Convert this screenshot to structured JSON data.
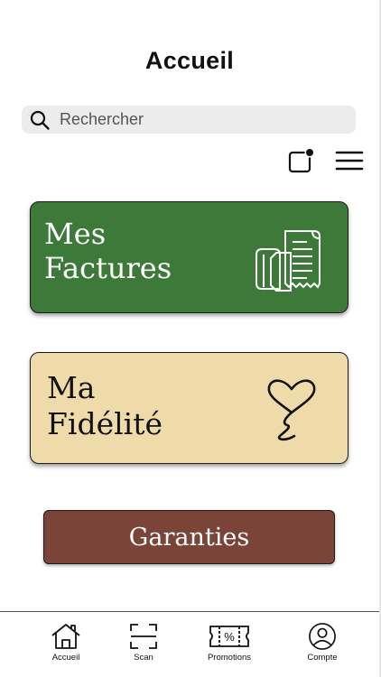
{
  "header": {
    "title": "Accueil"
  },
  "search": {
    "placeholder": "Rechercher",
    "icon": "search-icon"
  },
  "toolbar": {
    "notification_icon": "notification-icon",
    "menu_icon": "hamburger-menu-icon"
  },
  "cards": {
    "factures": {
      "line1": "Mes",
      "line2": "Factures",
      "color": "#3d7a3a",
      "icon": "receipts-icon"
    },
    "fidelite": {
      "line1": "Ma",
      "line2": "Fidélité",
      "color": "#efdaa9",
      "icon": "heart-balloon-icon"
    }
  },
  "garanties": {
    "label": "Garanties",
    "color": "#7a4538"
  },
  "bottom_nav": {
    "items": [
      {
        "label": "Accueil",
        "icon": "home-icon"
      },
      {
        "label": "Scan",
        "icon": "scan-icon"
      },
      {
        "label": "Promotions",
        "icon": "coupon-icon"
      },
      {
        "label": "Compte",
        "icon": "account-icon"
      }
    ]
  }
}
